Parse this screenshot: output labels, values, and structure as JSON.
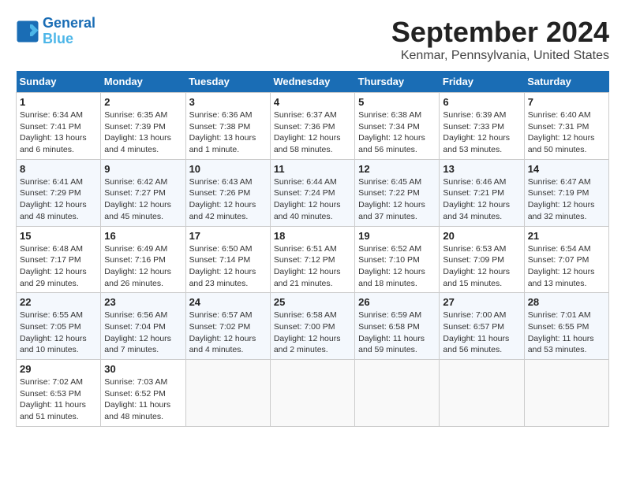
{
  "header": {
    "logo_line1": "General",
    "logo_line2": "Blue",
    "title": "September 2024",
    "subtitle": "Kenmar, Pennsylvania, United States"
  },
  "weekdays": [
    "Sunday",
    "Monday",
    "Tuesday",
    "Wednesday",
    "Thursday",
    "Friday",
    "Saturday"
  ],
  "weeks": [
    [
      {
        "day": "1",
        "info": "Sunrise: 6:34 AM\nSunset: 7:41 PM\nDaylight: 13 hours and 6 minutes."
      },
      {
        "day": "2",
        "info": "Sunrise: 6:35 AM\nSunset: 7:39 PM\nDaylight: 13 hours and 4 minutes."
      },
      {
        "day": "3",
        "info": "Sunrise: 6:36 AM\nSunset: 7:38 PM\nDaylight: 13 hours and 1 minute."
      },
      {
        "day": "4",
        "info": "Sunrise: 6:37 AM\nSunset: 7:36 PM\nDaylight: 12 hours and 58 minutes."
      },
      {
        "day": "5",
        "info": "Sunrise: 6:38 AM\nSunset: 7:34 PM\nDaylight: 12 hours and 56 minutes."
      },
      {
        "day": "6",
        "info": "Sunrise: 6:39 AM\nSunset: 7:33 PM\nDaylight: 12 hours and 53 minutes."
      },
      {
        "day": "7",
        "info": "Sunrise: 6:40 AM\nSunset: 7:31 PM\nDaylight: 12 hours and 50 minutes."
      }
    ],
    [
      {
        "day": "8",
        "info": "Sunrise: 6:41 AM\nSunset: 7:29 PM\nDaylight: 12 hours and 48 minutes."
      },
      {
        "day": "9",
        "info": "Sunrise: 6:42 AM\nSunset: 7:27 PM\nDaylight: 12 hours and 45 minutes."
      },
      {
        "day": "10",
        "info": "Sunrise: 6:43 AM\nSunset: 7:26 PM\nDaylight: 12 hours and 42 minutes."
      },
      {
        "day": "11",
        "info": "Sunrise: 6:44 AM\nSunset: 7:24 PM\nDaylight: 12 hours and 40 minutes."
      },
      {
        "day": "12",
        "info": "Sunrise: 6:45 AM\nSunset: 7:22 PM\nDaylight: 12 hours and 37 minutes."
      },
      {
        "day": "13",
        "info": "Sunrise: 6:46 AM\nSunset: 7:21 PM\nDaylight: 12 hours and 34 minutes."
      },
      {
        "day": "14",
        "info": "Sunrise: 6:47 AM\nSunset: 7:19 PM\nDaylight: 12 hours and 32 minutes."
      }
    ],
    [
      {
        "day": "15",
        "info": "Sunrise: 6:48 AM\nSunset: 7:17 PM\nDaylight: 12 hours and 29 minutes."
      },
      {
        "day": "16",
        "info": "Sunrise: 6:49 AM\nSunset: 7:16 PM\nDaylight: 12 hours and 26 minutes."
      },
      {
        "day": "17",
        "info": "Sunrise: 6:50 AM\nSunset: 7:14 PM\nDaylight: 12 hours and 23 minutes."
      },
      {
        "day": "18",
        "info": "Sunrise: 6:51 AM\nSunset: 7:12 PM\nDaylight: 12 hours and 21 minutes."
      },
      {
        "day": "19",
        "info": "Sunrise: 6:52 AM\nSunset: 7:10 PM\nDaylight: 12 hours and 18 minutes."
      },
      {
        "day": "20",
        "info": "Sunrise: 6:53 AM\nSunset: 7:09 PM\nDaylight: 12 hours and 15 minutes."
      },
      {
        "day": "21",
        "info": "Sunrise: 6:54 AM\nSunset: 7:07 PM\nDaylight: 12 hours and 13 minutes."
      }
    ],
    [
      {
        "day": "22",
        "info": "Sunrise: 6:55 AM\nSunset: 7:05 PM\nDaylight: 12 hours and 10 minutes."
      },
      {
        "day": "23",
        "info": "Sunrise: 6:56 AM\nSunset: 7:04 PM\nDaylight: 12 hours and 7 minutes."
      },
      {
        "day": "24",
        "info": "Sunrise: 6:57 AM\nSunset: 7:02 PM\nDaylight: 12 hours and 4 minutes."
      },
      {
        "day": "25",
        "info": "Sunrise: 6:58 AM\nSunset: 7:00 PM\nDaylight: 12 hours and 2 minutes."
      },
      {
        "day": "26",
        "info": "Sunrise: 6:59 AM\nSunset: 6:58 PM\nDaylight: 11 hours and 59 minutes."
      },
      {
        "day": "27",
        "info": "Sunrise: 7:00 AM\nSunset: 6:57 PM\nDaylight: 11 hours and 56 minutes."
      },
      {
        "day": "28",
        "info": "Sunrise: 7:01 AM\nSunset: 6:55 PM\nDaylight: 11 hours and 53 minutes."
      }
    ],
    [
      {
        "day": "29",
        "info": "Sunrise: 7:02 AM\nSunset: 6:53 PM\nDaylight: 11 hours and 51 minutes."
      },
      {
        "day": "30",
        "info": "Sunrise: 7:03 AM\nSunset: 6:52 PM\nDaylight: 11 hours and 48 minutes."
      },
      {
        "day": "",
        "info": ""
      },
      {
        "day": "",
        "info": ""
      },
      {
        "day": "",
        "info": ""
      },
      {
        "day": "",
        "info": ""
      },
      {
        "day": "",
        "info": ""
      }
    ]
  ]
}
